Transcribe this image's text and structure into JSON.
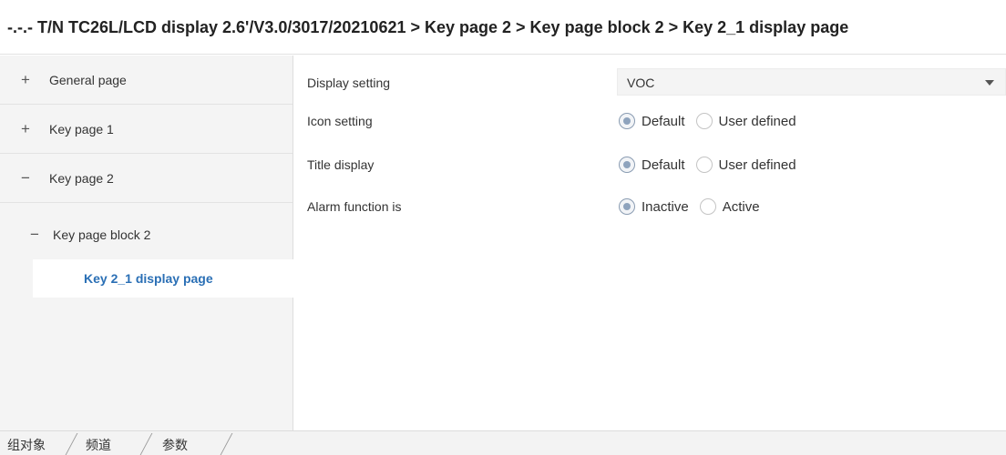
{
  "header": {
    "breadcrumb": "-.-.- T/N TC26L/LCD display 2.6'/V3.0/3017/20210621 > Key page 2 > Key page block 2 > Key 2_1 display page"
  },
  "sidebar": {
    "items": [
      {
        "toggle": "+",
        "label": "General page"
      },
      {
        "toggle": "+",
        "label": "Key page 1"
      },
      {
        "toggle": "−",
        "label": "Key page 2"
      },
      {
        "toggle": "−",
        "label": "Key page block 2"
      },
      {
        "toggle": "",
        "label": "Key 2_1 display page"
      }
    ]
  },
  "settings": {
    "display_setting": {
      "label": "Display setting",
      "value": "VOC"
    },
    "icon_setting": {
      "label": "Icon setting",
      "options": [
        "Default",
        "User defined"
      ],
      "selected": "Default"
    },
    "title_display": {
      "label": "Title display",
      "options": [
        "Default",
        "User defined"
      ],
      "selected": "Default"
    },
    "alarm_function": {
      "label": "Alarm function is",
      "options": [
        "Inactive",
        "Active"
      ],
      "selected": "Inactive"
    }
  },
  "tabs": [
    "组对象",
    "频道",
    "参数"
  ],
  "colors": {
    "accent": "#2a6fb5",
    "sidebar_bg": "#f4f4f4",
    "radio_checked": "#8ea3bd"
  }
}
